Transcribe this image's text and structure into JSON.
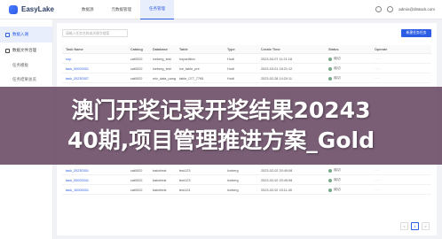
{
  "app": {
    "name": "EasyLake"
  },
  "topnav": {
    "tabs": [
      "数据源",
      "元数据管理",
      "任务管理"
    ],
    "active_index": 2
  },
  "user": {
    "email": "admin@dtstack.com"
  },
  "sidebar": {
    "items": [
      {
        "label": "数据入湖",
        "active": true
      },
      {
        "label": "数据文件治理",
        "active": false
      }
    ],
    "subitems": [
      "任务模板",
      "任务结果总览"
    ]
  },
  "main": {
    "search_placeholder": "请输入任务名称或关键字搜索",
    "new_button": "新建任务任务",
    "table": {
      "headers": [
        "Task Name",
        "Catalog",
        "Database",
        "Table",
        "Type",
        "Create Time",
        "Status",
        "Operate"
      ],
      "rows": [
        {
          "name": "nop",
          "catalog": "cat0002",
          "database": "iceberg_test",
          "table": "hopartition",
          "type": "Hudi",
          "time": "2023-04-07 11:21:18",
          "status": "成功"
        },
        {
          "name": "task_00020001",
          "catalog": "cat0002",
          "database": "iceberg_test",
          "table": "ice_table_pre",
          "type": "Hudi",
          "time": "2023-03-01 18:21:12",
          "status": "成功"
        },
        {
          "name": "task_20230307",
          "catalog": "cat0002",
          "database": "mix_data_pang",
          "table": "table_077_7765",
          "type": "Hudi",
          "time": "2023-02-28 14:20:11",
          "status": "成功"
        },
        {
          "name": "task_20230301",
          "catalog": "cat0002",
          "database": "batchtest",
          "table": "test123",
          "type": "Iceberg",
          "time": "2023-02-02 20:49:08",
          "status": "成功"
        },
        {
          "name": "task_00020041",
          "catalog": "cat0002",
          "database": "batchtest",
          "table": "test123",
          "type": "Iceberg",
          "time": "2023-02-02 20:49:08",
          "status": "成功"
        },
        {
          "name": "task_10000001",
          "catalog": "cat0002",
          "database": "batchtest",
          "table": "test124",
          "type": "Iceberg",
          "time": "2023-02-02 15:11:40",
          "status": "成功"
        }
      ]
    },
    "pagination": {
      "prev": "<",
      "current": "1",
      "next": ">"
    }
  },
  "overlay": {
    "line1": "澳门开奖记录开奖结果20243",
    "line2": "40期,项目管理推进方案_Gold"
  }
}
